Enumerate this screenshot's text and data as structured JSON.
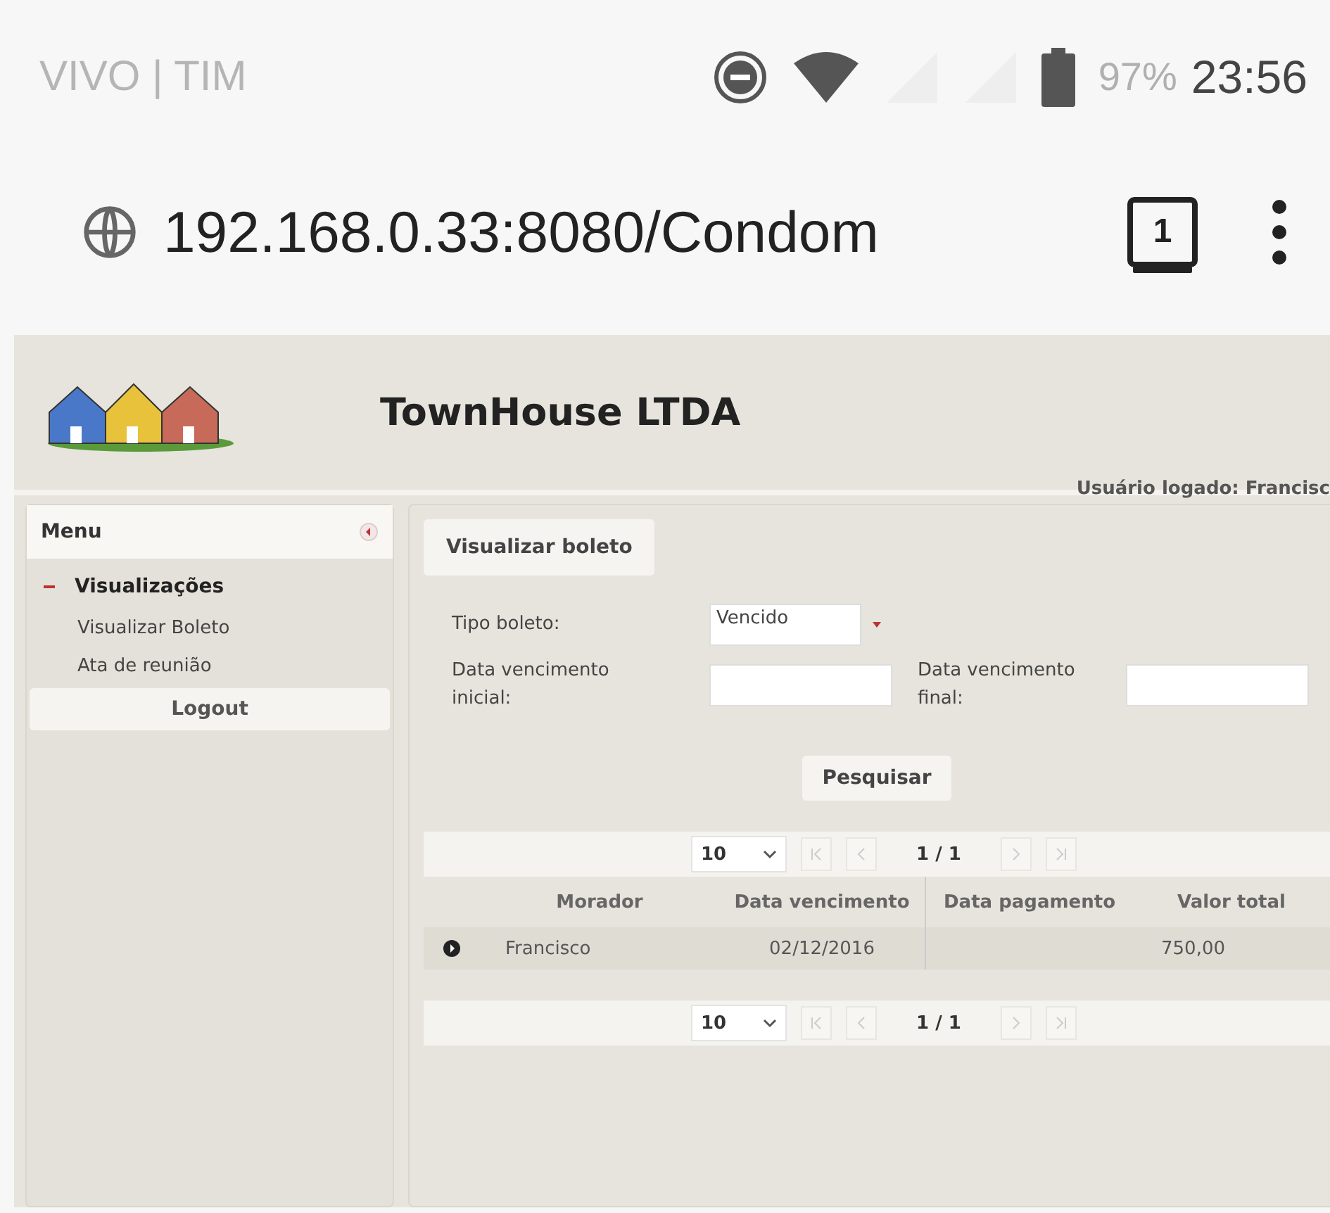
{
  "status_bar": {
    "carrier": "VIVO | TIM",
    "battery": "97%",
    "time": "23:56"
  },
  "browser": {
    "url": "192.168.0.33:8080/Condom",
    "tab_count": "1"
  },
  "header": {
    "title": "TownHouse LTDA",
    "user": "Usuário logado: Francisc"
  },
  "menu": {
    "title": "Menu",
    "sections": [
      {
        "label": "Visualizações",
        "expanded": true,
        "items": [
          "Visualizar Boleto",
          "Ata de reunião"
        ]
      }
    ],
    "logout": "Logout"
  },
  "panel": {
    "tab": "Visualizar boleto",
    "tipo": {
      "label": "Tipo boleto:",
      "value": "Vencido"
    },
    "dates": [
      {
        "label": "Data vencimento inicial:"
      },
      {
        "label": "Data vencimento final:"
      }
    ],
    "search_button": "Pesquisar"
  },
  "table": {
    "pagers": [
      {
        "page_size": "10",
        "page": "1 / 1"
      },
      {
        "page_size": "10",
        "page": "1 / 1"
      }
    ],
    "columns": [
      "Morador",
      "Data vencimento",
      "Data pagamento",
      "Valor total"
    ],
    "rows": [
      {
        "morador": "Francisco",
        "vencimento": "02/12/2016",
        "valor": "750,00",
        "expanded": false
      }
    ]
  }
}
